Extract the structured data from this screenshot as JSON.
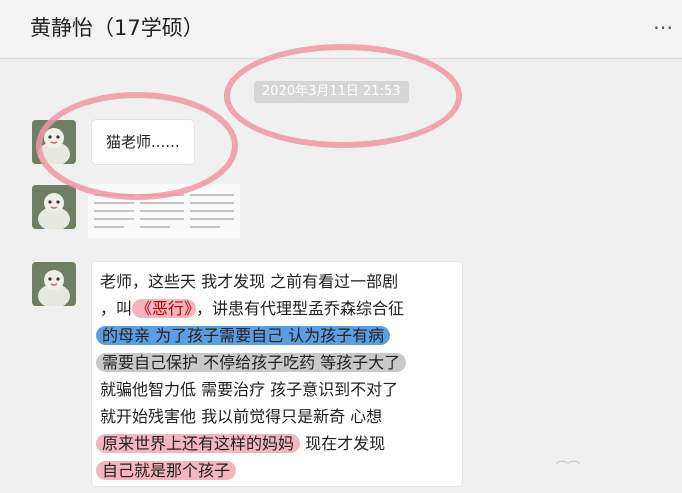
{
  "header": {
    "title": "黄静怡（17学硕）",
    "more_icon": "more-dots-icon"
  },
  "chat": {
    "timestamp": "2020年3月11日 21:53",
    "messages": [
      {
        "type": "text",
        "text": "猫老师......"
      },
      {
        "type": "image"
      },
      {
        "type": "text",
        "lines": {
          "l1": "老师，这些天 我才发现  之前有看过一部剧",
          "l2a": "，叫",
          "l2b": "《恶行》",
          "l2c": "，讲患有代理型孟乔森综合征",
          "l3": "的母亲   为了孩子需要自己 认为孩子有病",
          "l4": "需要自己保护  不停给孩子吃药  等孩子大了",
          "l5": "就骗他智力低  需要治疗  孩子意识到不对了",
          "l6": "就开始残害他   我以前觉得只是新奇  心想",
          "l7a": "原来世界上还有这样的妈妈",
          "l7b": "  现在才发现",
          "l8": "自己就是那个孩子"
        }
      }
    ]
  },
  "colors": {
    "highlight_blue": "#5b9fe2",
    "highlight_gray": "#c9c9c9",
    "highlight_pink": "#f3b6bf",
    "annotation_ellipse": "#f096a5"
  }
}
